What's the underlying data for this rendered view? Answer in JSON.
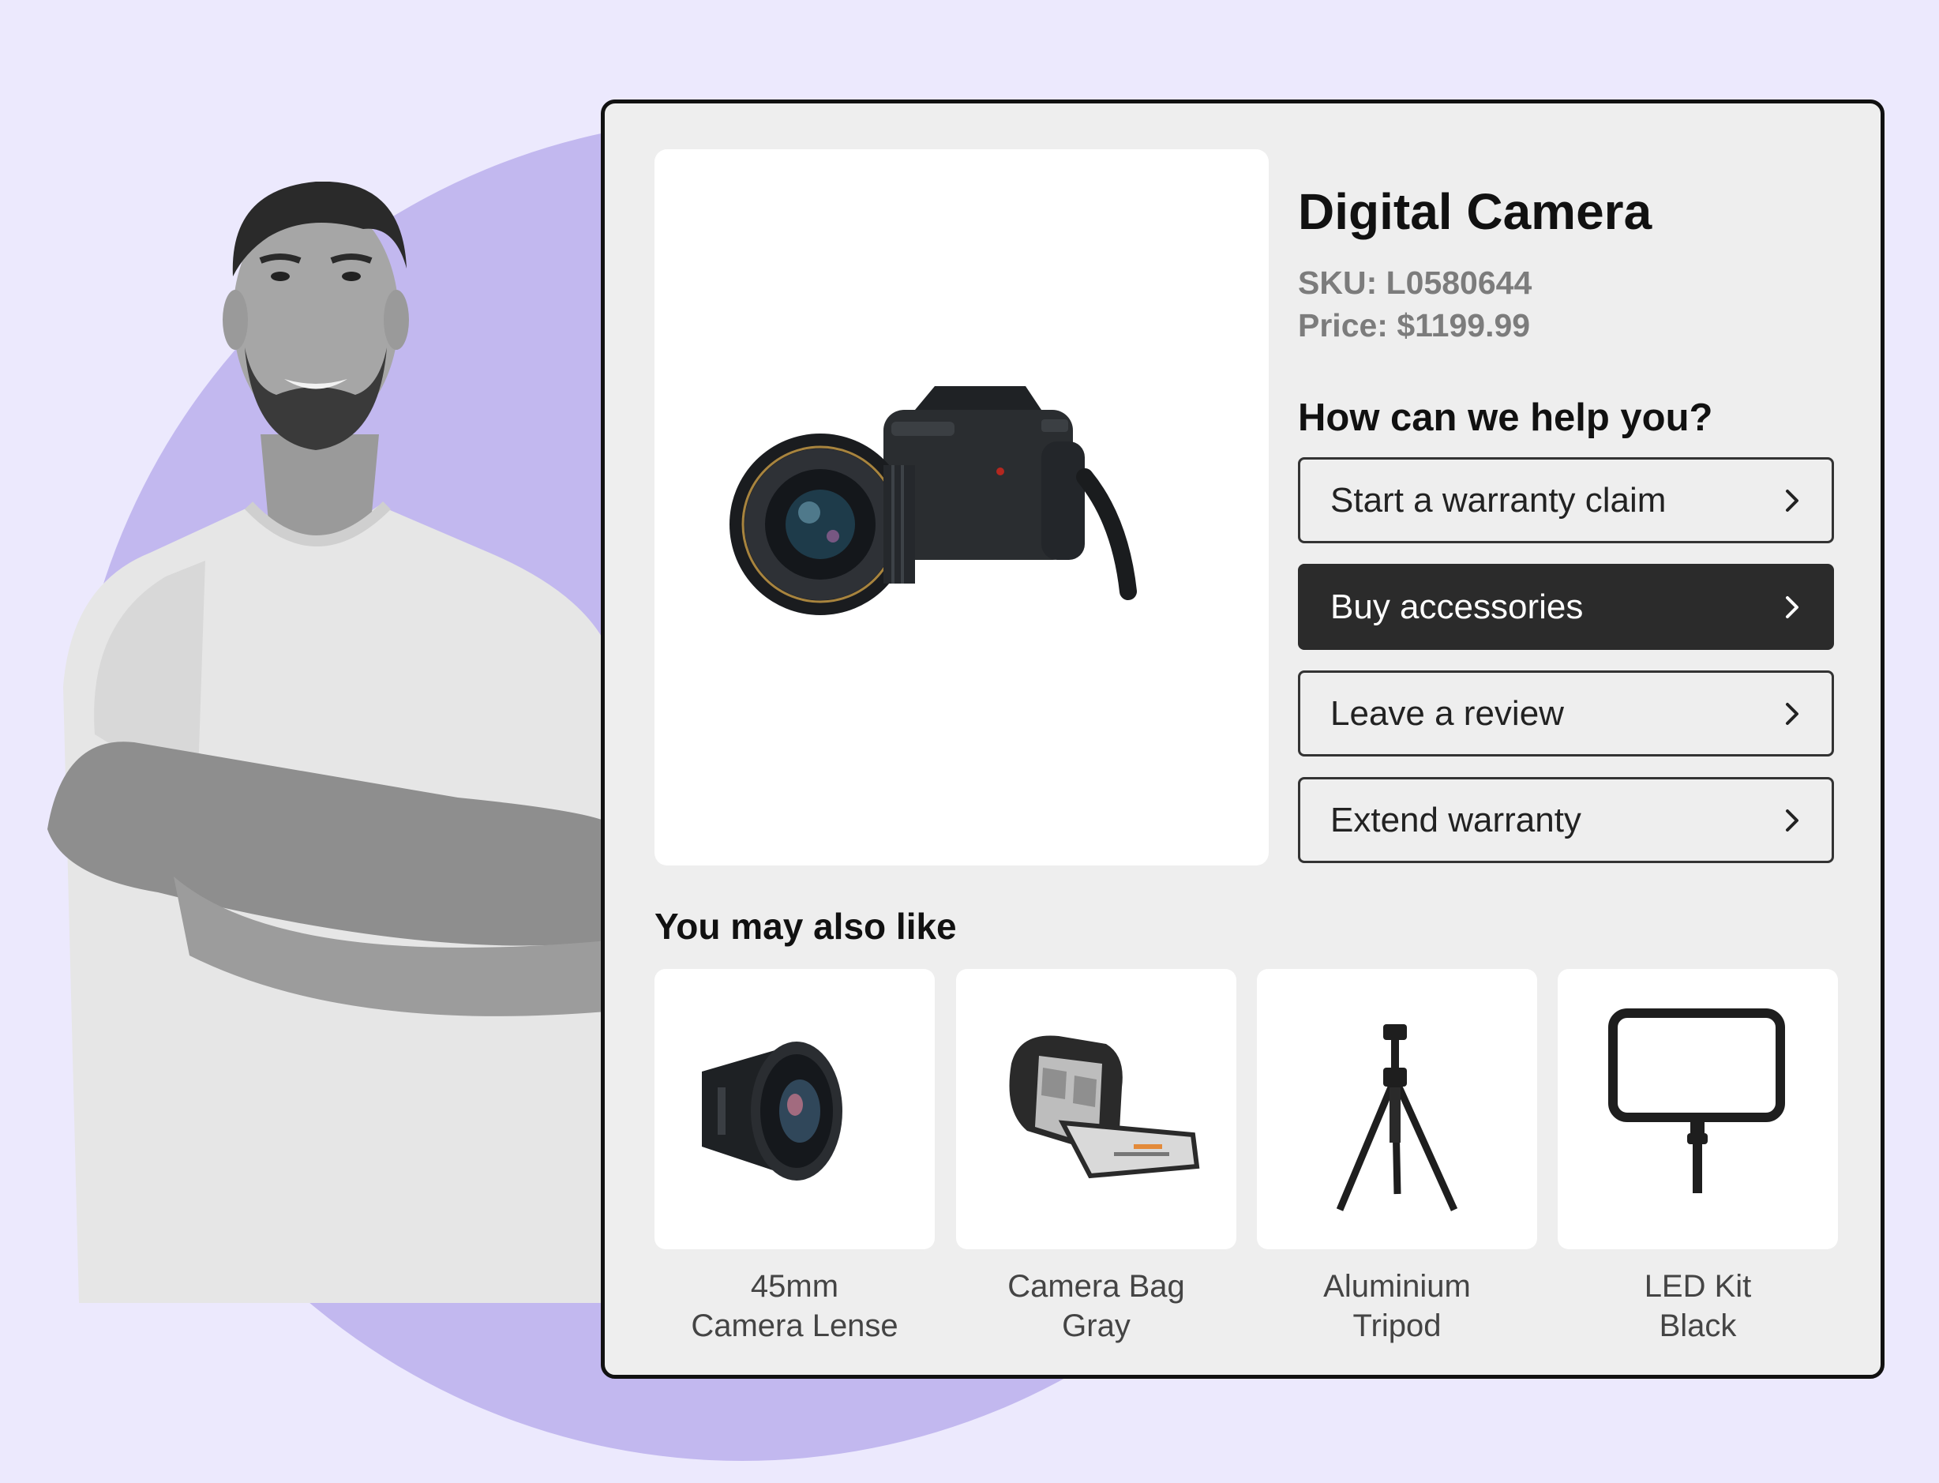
{
  "product": {
    "name": "Digital Camera",
    "sku": "SKU: L0580644",
    "price": "Price: $1199.99"
  },
  "help": {
    "heading": "How can we help you?",
    "actions": [
      {
        "label": "Start a warranty claim",
        "selected": false
      },
      {
        "label": "Buy accessories",
        "selected": true
      },
      {
        "label": "Leave a review",
        "selected": false
      },
      {
        "label": "Extend warranty",
        "selected": false
      }
    ]
  },
  "recommendations": {
    "heading": "You may also like",
    "items": [
      {
        "line1": "45mm",
        "line2": "Camera Lense",
        "icon": "lens-icon"
      },
      {
        "line1": "Camera Bag",
        "line2": "Gray",
        "icon": "camera-bag-icon"
      },
      {
        "line1": "Aluminium",
        "line2": "Tripod",
        "icon": "tripod-icon"
      },
      {
        "line1": "LED Kit",
        "line2": "Black",
        "icon": "led-panel-icon"
      }
    ]
  },
  "colors": {
    "page_background": "#ECE9FD",
    "accent_circle": "#C2B8EF",
    "card_background": "#EEEEEE",
    "selected_button": "#2B2B2B"
  }
}
